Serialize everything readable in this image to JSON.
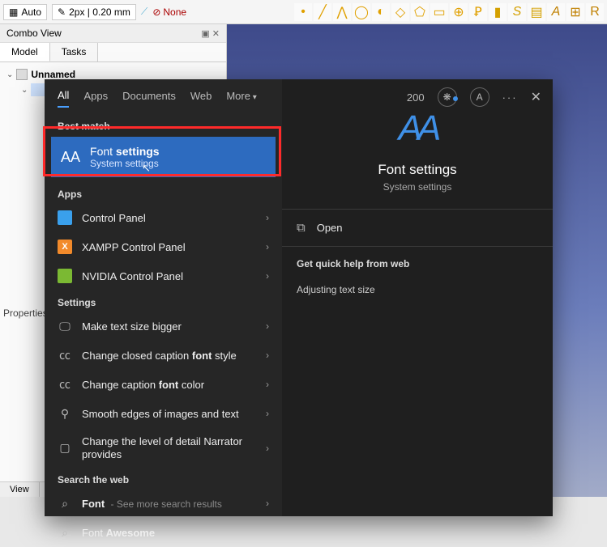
{
  "bg": {
    "auto": "Auto",
    "linewidth": "2px | 0.20 mm",
    "none": "None",
    "combo_title": "Combo View",
    "tab_model": "Model",
    "tab_tasks": "Tasks",
    "tree_doc": "Unnamed",
    "properties": "Properties",
    "view_tab": "View"
  },
  "search": {
    "tabs": {
      "all": "All",
      "apps": "Apps",
      "documents": "Documents",
      "web": "Web",
      "more": "More"
    },
    "points": "200",
    "avatar_letter": "A",
    "sections": {
      "best": "Best match",
      "apps": "Apps",
      "settings": "Settings",
      "web": "Search the web"
    },
    "best": {
      "icon": "AA",
      "title_pre": "Font ",
      "title_bold": "settings",
      "subtitle": "System settings"
    },
    "apps_list": [
      {
        "icon_type": "cp",
        "icon_text": "",
        "label": "Control Panel"
      },
      {
        "icon_type": "xa",
        "icon_text": "X",
        "label": "XAMPP Control Panel"
      },
      {
        "icon_type": "nv",
        "icon_text": "",
        "label": "NVIDIA Control Panel"
      }
    ],
    "settings_list": [
      {
        "label": "Make text size bigger"
      },
      {
        "label_pre": "Change closed caption ",
        "label_bold": "font",
        "label_post": " style"
      },
      {
        "label_pre": "Change caption ",
        "label_bold": "font",
        "label_post": " color"
      },
      {
        "label": "Smooth edges of images and text"
      },
      {
        "label": "Change the level of detail Narrator provides",
        "multi": true
      }
    ],
    "web_list": [
      {
        "prefix": "Font",
        "suffix": " - See more search results"
      },
      {
        "prefix": "Font ",
        "bold": "Awesome"
      }
    ],
    "preview": {
      "big_icon": "AA",
      "title_pre": "Font ",
      "title_bold": "settings",
      "subtitle": "System settings",
      "open": "Open",
      "help_label": "Get quick help from web",
      "help_items": [
        "Adjusting text size"
      ]
    }
  }
}
